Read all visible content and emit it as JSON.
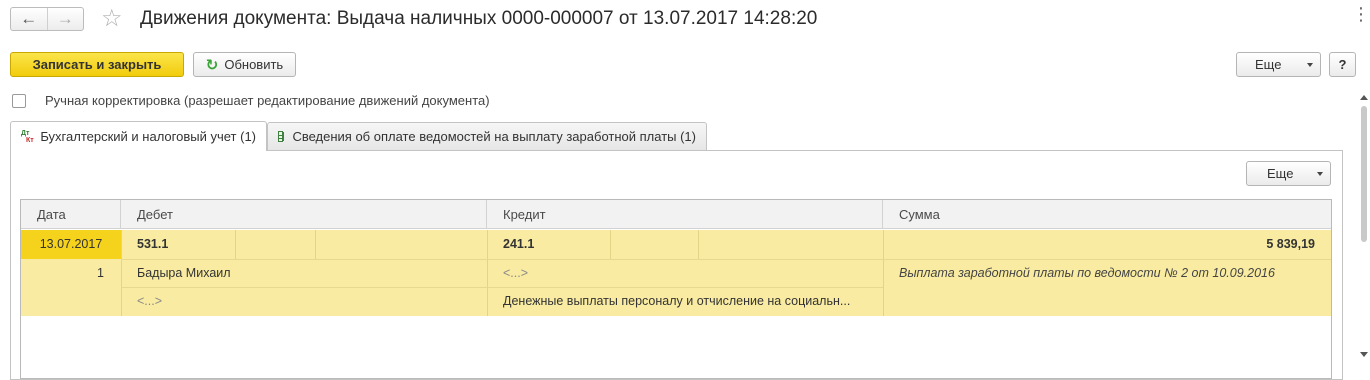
{
  "window": {
    "title": "Движения документа: Выдача наличных 0000-000007 от 13.07.2017 14:28:20",
    "back_icon": "←",
    "forward_icon": "→",
    "favorite_icon": "☆",
    "more_icon": "⋮"
  },
  "toolbar": {
    "save_close_label": "Записать и закрыть",
    "refresh_icon": "↻",
    "refresh_label": "Обновить",
    "more_label": "Еще",
    "help_label": "?"
  },
  "manual_correction": {
    "label": "Ручная корректировка (разрешает редактирование движений документа)",
    "checked": false
  },
  "tabs": [
    {
      "label": "Бухгалтерский и налоговый учет (1)",
      "icon": "dt-kt-icon",
      "active": true
    },
    {
      "label": "Сведения об оплате ведомостей на выплату заработной платы (1)",
      "icon": "table-grid-icon",
      "active": false
    }
  ],
  "panel": {
    "more_label": "Еще"
  },
  "table": {
    "columns": [
      "Дата",
      "Дебет",
      "Кредит",
      "Сумма"
    ],
    "rows": [
      {
        "date": "13.07.2017",
        "number": "1",
        "debit_account": "531.1",
        "debit_subconto1": "Бадыра Михаил",
        "debit_subconto2": "<...>",
        "credit_account": "241.1",
        "credit_subconto1": "<...>",
        "credit_subconto2": "Денежные выплаты персоналу и отчисление на социальн...",
        "amount": "5 839,19",
        "content": "Выплата заработной платы по ведомости № 2 от 10.09.2016"
      }
    ]
  },
  "colors": {
    "primary_button": "#f2cc0c",
    "selected_row": "#f9eca2",
    "selected_date_cell": "#f5d21c"
  }
}
